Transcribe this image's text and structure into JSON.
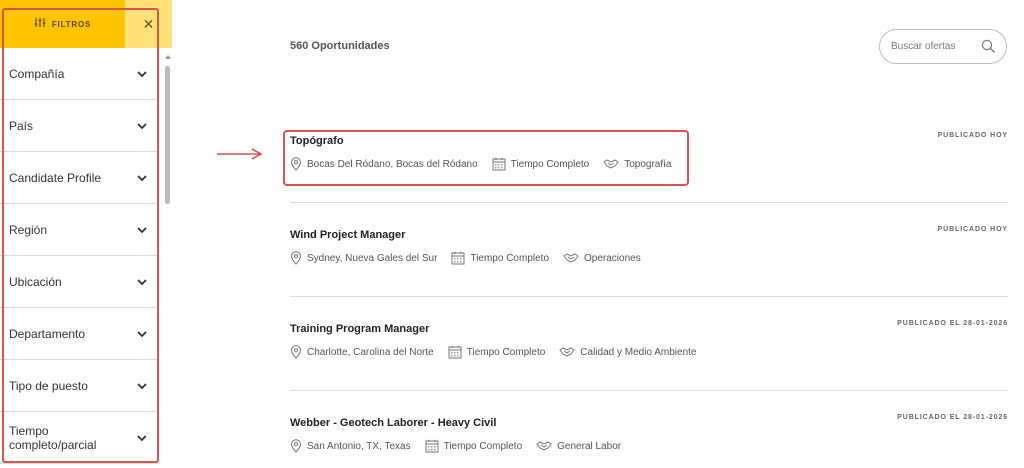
{
  "filters": {
    "header_label": "FILTROS",
    "close_symbol": "✕",
    "items": [
      {
        "label": "Compañía"
      },
      {
        "label": "País"
      },
      {
        "label": "Candidate Profile"
      },
      {
        "label": "Región"
      },
      {
        "label": "Ubicación"
      },
      {
        "label": "Departamento"
      },
      {
        "label": "Tipo de puesto"
      },
      {
        "label": "Tiempo completo/parcial"
      }
    ]
  },
  "main": {
    "count_text": "560 Oportunidades",
    "search": {
      "placeholder": "Buscar ofertas"
    },
    "jobs": [
      {
        "title": "Topógrafo",
        "location": "Bocas Del Ródano, Bocas del Ródano",
        "schedule": "Tiempo Completo",
        "area": "Topografía",
        "date": "PUBLICADO HOY"
      },
      {
        "title": "Wind Project Manager",
        "location": "Sydney, Nueva Gales del Sur",
        "schedule": "Tiempo Completo",
        "area": "Operaciones",
        "date": "PUBLICADO HOY"
      },
      {
        "title": "Training Program Manager",
        "location": "Charlotte, Carolina del Norte",
        "schedule": "Tiempo Completo",
        "area": "Calidad y Medio Ambiente",
        "date": "PUBLICADO EL 28-01-2026"
      },
      {
        "title": "Webber - Geotech Laborer - Heavy Civil",
        "location": "San Antonio, TX, Texas",
        "schedule": "Tiempo Completo",
        "area": "General Labor",
        "date": "PUBLICADO EL 28-01-2026"
      }
    ]
  },
  "colors": {
    "accent": "#ffc400",
    "accent_light": "#ffe17a",
    "annotation": "#d9534f"
  },
  "icons": [
    "sliders-icon",
    "close-icon",
    "chevron-down-icon",
    "search-icon",
    "location-pin-icon",
    "calendar-icon",
    "handshake-icon",
    "arrow-right-icon"
  ]
}
